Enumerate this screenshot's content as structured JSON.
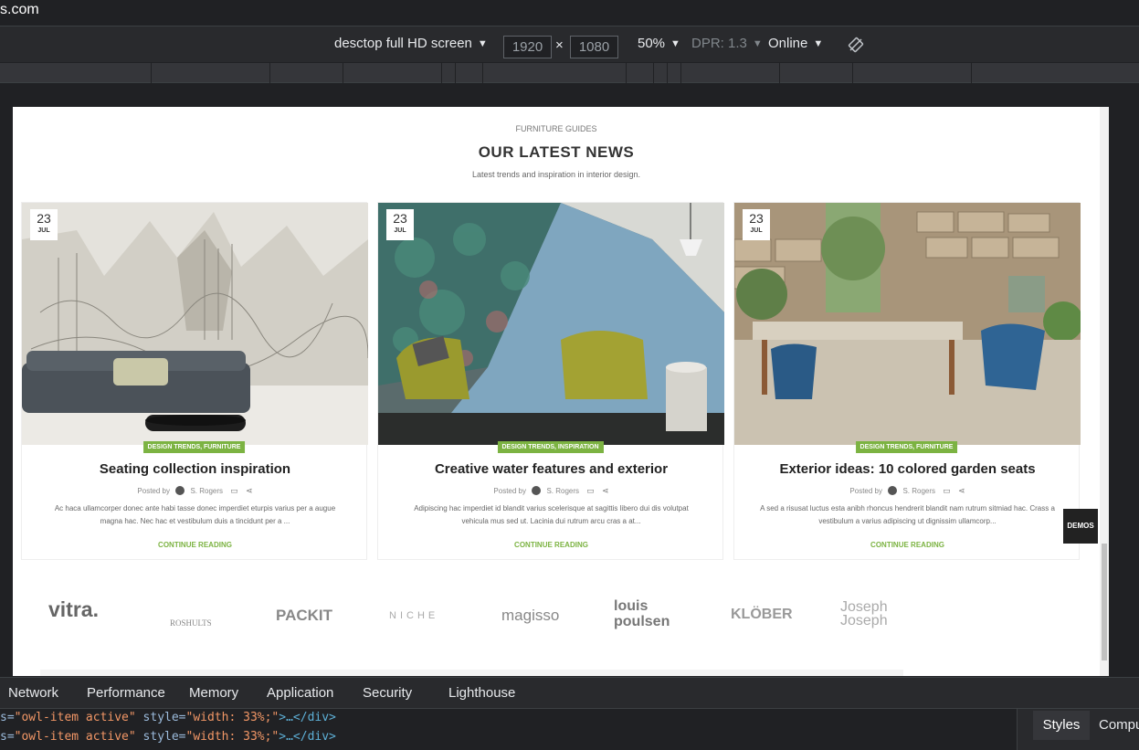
{
  "browser": {
    "url_fragment": "s.com"
  },
  "device_toolbar": {
    "device": "desctop full HD screen",
    "width": "1920",
    "height": "1080",
    "times": "×",
    "zoom": "50%",
    "dpr": "DPR: 1.3",
    "network": "Online"
  },
  "page": {
    "section_subtitle": "FURNITURE GUIDES",
    "section_title": "OUR LATEST NEWS",
    "section_desc": "Latest trends and inspiration in interior design.",
    "cards": [
      {
        "day": "23",
        "month": "JUL",
        "category": "DESIGN TRENDS, FURNITURE",
        "title": "Seating collection inspiration",
        "posted_by": "Posted by",
        "author": "S. Rogers",
        "excerpt": "Ac haca ullamcorper donec ante habi tasse donec imperdiet eturpis varius per a augue magna hac. Nec hac et vestibulum duis a tincidunt per a ...",
        "more": "CONTINUE READING"
      },
      {
        "day": "23",
        "month": "JUL",
        "category": "DESIGN TRENDS, INSPIRATION",
        "title": "Creative water features and exterior",
        "posted_by": "Posted by",
        "author": "S. Rogers",
        "excerpt": "Adipiscing hac imperdiet id blandit varius scelerisque at sagittis libero dui dis volutpat vehicula mus sed ut. Lacinia dui rutrum arcu cras a at...",
        "more": "CONTINUE READING"
      },
      {
        "day": "23",
        "month": "JUL",
        "category": "DESIGN TRENDS, FURNITURE",
        "title": "Exterior ideas: 10 colored garden seats",
        "posted_by": "Posted by",
        "author": "S. Rogers",
        "excerpt": "A sed a risusat luctus esta anibh rhoncus hendrerit blandit nam rutrum sitmiad hac. Crass a vestibulum a varius adipiscing ut dignissim ullamcorp...",
        "more": "CONTINUE READING"
      }
    ],
    "demos_badge": "DEMOS",
    "brands": [
      "vitra.",
      "ROSHULTS",
      "PACKIT",
      "NICHE",
      "magisso",
      "louis poulsen",
      "KLÖBER",
      "Joseph Joseph"
    ]
  },
  "devtools": {
    "tabs": [
      "Network",
      "Performance",
      "Memory",
      "Application",
      "Security",
      "Lighthouse"
    ],
    "code_lines": [
      {
        "prefix": "s=",
        "class_val": "\"owl-item active\"",
        "style_attr": "style=",
        "style_val": "\"width: 33%;\"",
        "tail": ">…</div>"
      },
      {
        "prefix": "s=",
        "class_val": "\"owl-item active\"",
        "style_attr": "style=",
        "style_val": "\"width: 33%;\"",
        "tail": ">…</div>"
      }
    ],
    "side_tabs": {
      "styles": "Styles",
      "computed": "Compu"
    }
  },
  "colors": {
    "accent_green": "#7cb342",
    "devtools_bg": "#202124"
  }
}
